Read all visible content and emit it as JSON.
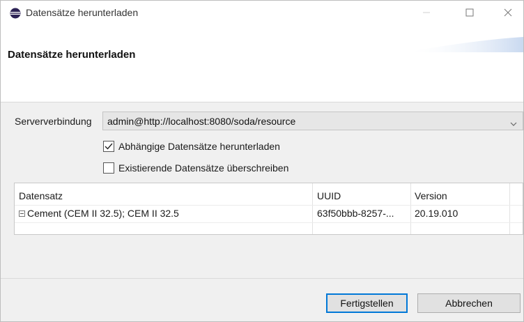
{
  "window": {
    "title": "Datensätze herunterladen",
    "icon": "eclipse-icon"
  },
  "banner": {
    "title": "Datensätze herunterladen"
  },
  "server": {
    "label": "Serververbindung",
    "value": "admin@http://localhost:8080/soda/resource"
  },
  "options": {
    "dependent_label": "Abhängige Datensätze herunterladen",
    "dependent_checked": true,
    "overwrite_label": "Existierende Datensätze überschreiben",
    "overwrite_checked": false
  },
  "table": {
    "headers": [
      "Datensatz",
      "UUID",
      "Version"
    ],
    "rows": [
      {
        "name": "Cement (CEM II 32.5); CEM II 32.5",
        "uuid": "63f50bbb-8257-...",
        "version": "20.19.010"
      }
    ]
  },
  "buttons": {
    "finish": "Fertigstellen",
    "cancel": "Abbrechen"
  },
  "colors": {
    "accent": "#0078d7",
    "window_bg": "#f0f0f0"
  }
}
